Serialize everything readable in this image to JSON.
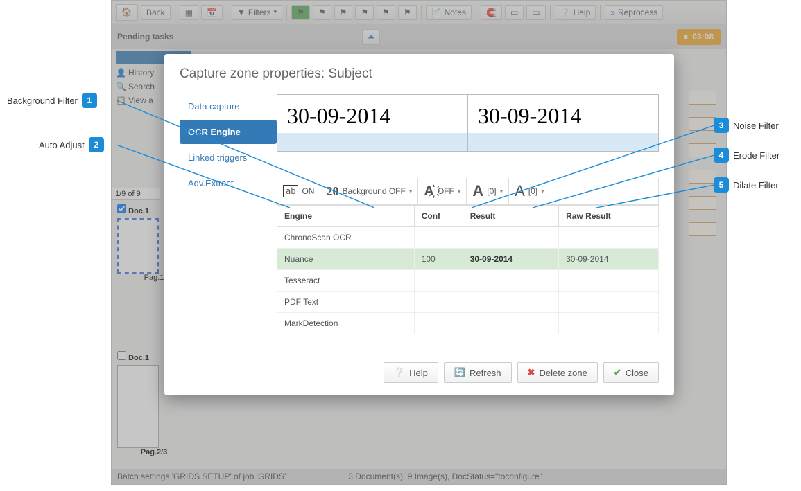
{
  "toolbar": {
    "back": "Back",
    "filters": "Filters",
    "notes": "Notes",
    "help": "Help",
    "reprocess": "Reprocess"
  },
  "pending": {
    "label": "Pending tasks",
    "timer": "03:08"
  },
  "leftPanel": {
    "history": "History",
    "search": "Search",
    "viewAll": "View a"
  },
  "pageInfo": "1/9 of 9",
  "docs": {
    "d1": "Doc.1",
    "pg1": "Pag.1",
    "d2": "Doc.1",
    "pg2": "Pag.2/3"
  },
  "status": {
    "left": "Batch settings 'GRIDS SETUP' of job 'GRIDS'",
    "right": "3 Document(s), 9 Image(s), DocStatus=\"toconfigure\""
  },
  "modal": {
    "title": "Capture zone properties: Subject",
    "tabs": {
      "dc": "Data capture",
      "ocr": "OCR Engine",
      "lt": "Linked triggers",
      "ae": "Adv.Extract"
    },
    "preview": {
      "left": "30-09-2014",
      "right": "30-09-2014"
    },
    "filters": {
      "f1_icon": "ab",
      "f1_label": "ON",
      "f2_icon": "20",
      "f2_label": "Background OFF",
      "f3_label": "OFF",
      "f4_label": "[0]",
      "f5_label": "[0]"
    },
    "table": {
      "h1": "Engine",
      "h2": "Conf",
      "h3": "Result",
      "h4": "Raw Result",
      "r1": {
        "e": "ChronoScan OCR",
        "c": "",
        "res": "",
        "raw": ""
      },
      "r2": {
        "e": "Nuance",
        "c": "100",
        "res": "30-09-2014",
        "raw": "30-09-2014"
      },
      "r3": {
        "e": "Tesseract",
        "c": "",
        "res": "",
        "raw": ""
      },
      "r4": {
        "e": "PDF Text",
        "c": "",
        "res": "",
        "raw": ""
      },
      "r5": {
        "e": "MarkDetection",
        "c": "",
        "res": "",
        "raw": ""
      }
    },
    "footer": {
      "help": "Help",
      "refresh": "Refresh",
      "delete": "Delete zone",
      "close": "Close"
    }
  },
  "callouts": {
    "c1": "Background Filter",
    "c2": "Auto Adjust",
    "c3": "Noise Filter",
    "c4": "Erode Filter",
    "c5": "Dilate Filter"
  }
}
